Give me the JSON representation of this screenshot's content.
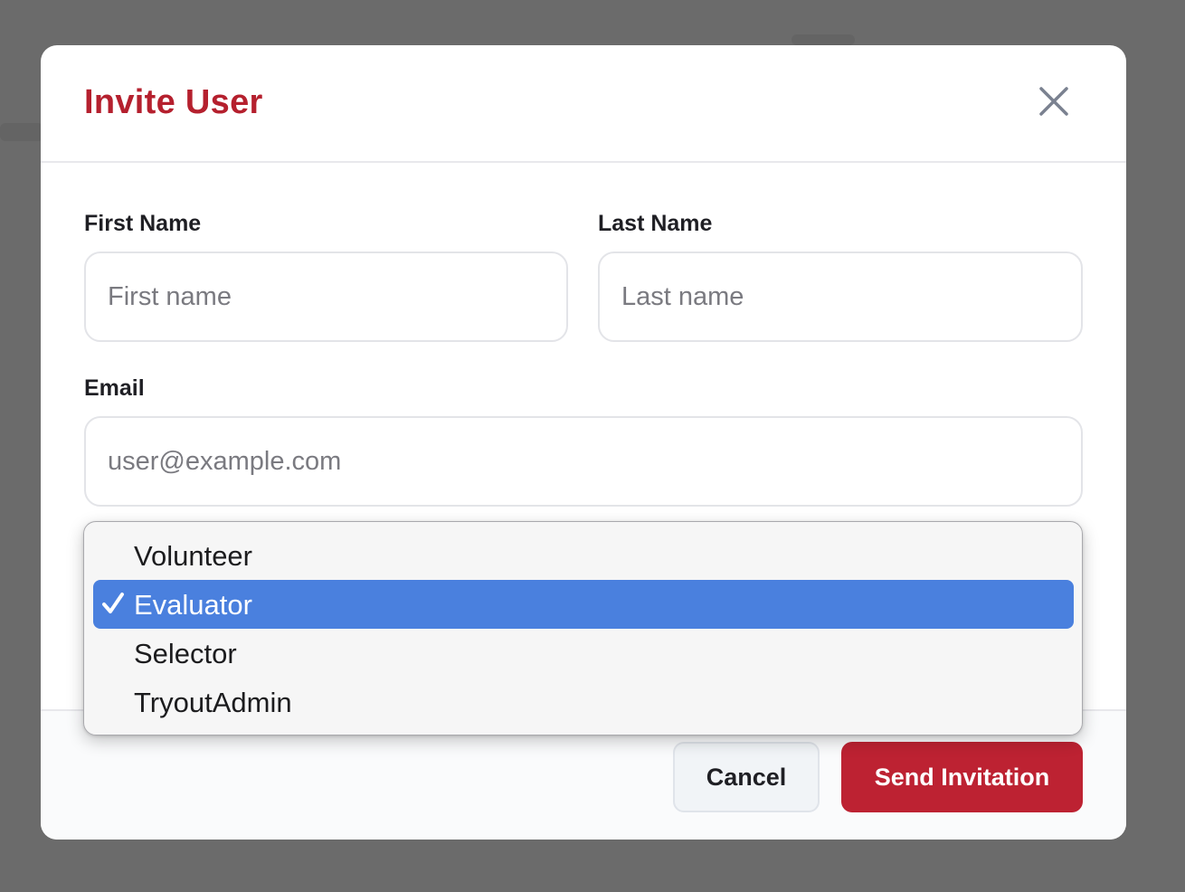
{
  "modal": {
    "title": "Invite User",
    "close_icon": "close-icon"
  },
  "form": {
    "first_name": {
      "label": "First Name",
      "placeholder": "First name",
      "value": ""
    },
    "last_name": {
      "label": "Last Name",
      "placeholder": "Last name",
      "value": ""
    },
    "email": {
      "label": "Email",
      "placeholder": "user@example.com",
      "value": ""
    },
    "role": {
      "options": [
        "Volunteer",
        "Evaluator",
        "Selector",
        "TryoutAdmin"
      ],
      "selected": "Evaluator"
    }
  },
  "footer": {
    "cancel_label": "Cancel",
    "send_label": "Send Invitation"
  },
  "colors": {
    "accent": "#b5202e",
    "primary_button": "#bd2232",
    "selection": "#4a80de"
  }
}
